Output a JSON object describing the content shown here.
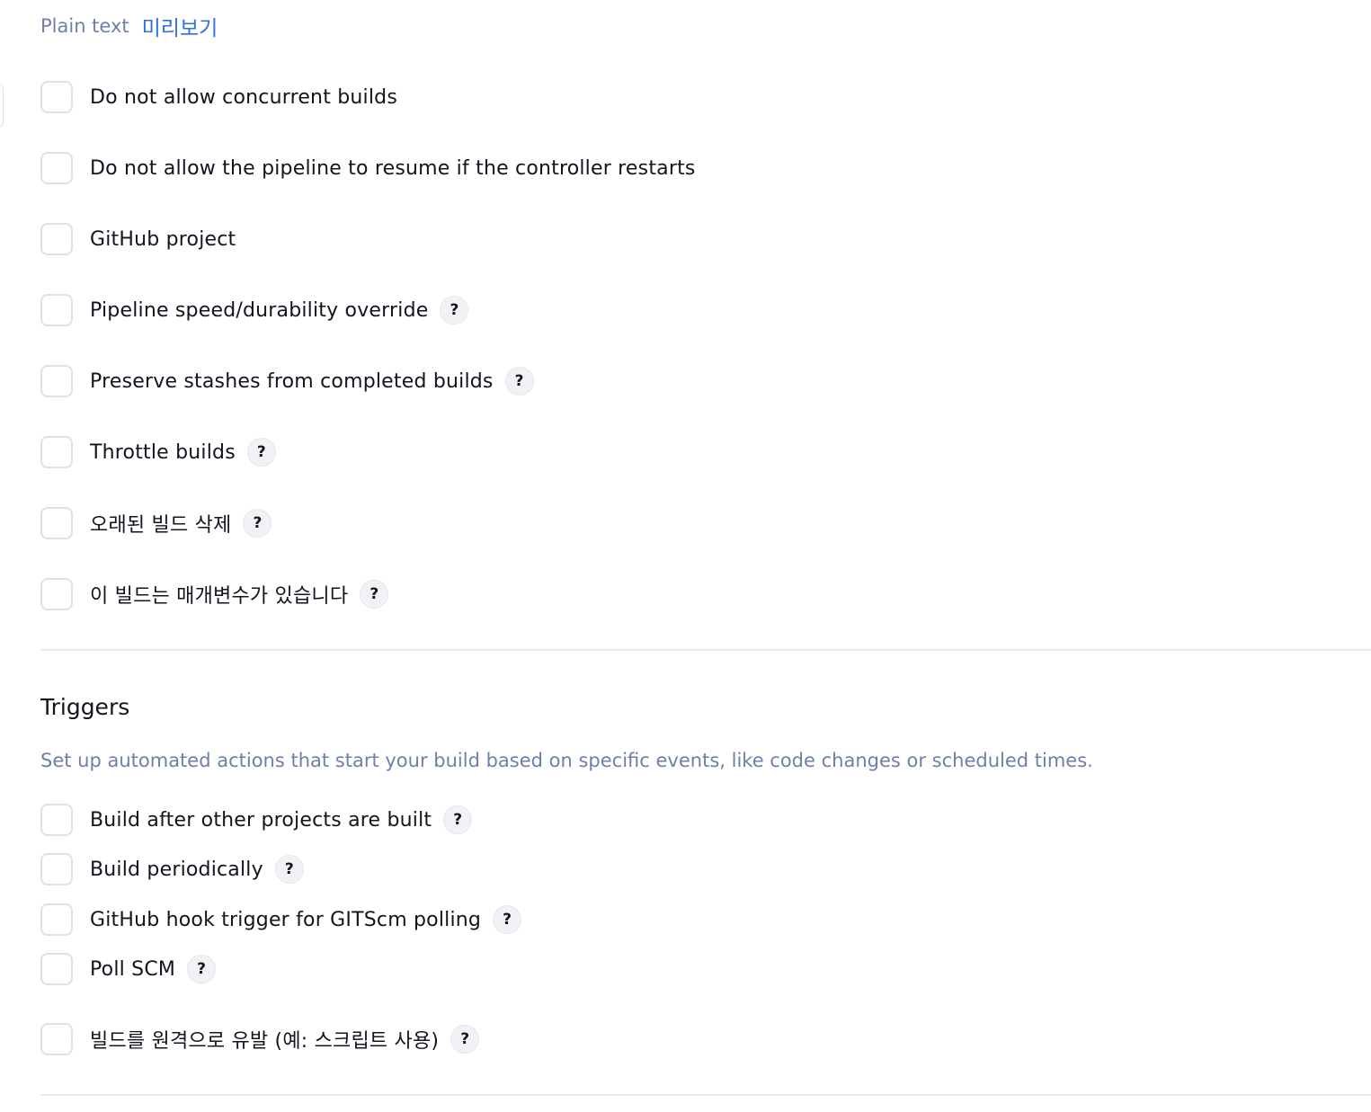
{
  "description_format": {
    "plain_text_label": "Plain text",
    "preview_link": "미리보기"
  },
  "general_options": [
    {
      "label": "Do not allow concurrent builds",
      "checked": false,
      "help": false
    },
    {
      "label": "Do not allow the pipeline to resume if the controller restarts",
      "checked": false,
      "help": false
    },
    {
      "label": "GitHub project",
      "checked": false,
      "help": false
    },
    {
      "label": "Pipeline speed/durability override",
      "checked": false,
      "help": true,
      "help_glyph": "?"
    },
    {
      "label": "Preserve stashes from completed builds",
      "checked": false,
      "help": true,
      "help_glyph": "?"
    },
    {
      "label": "Throttle builds",
      "checked": false,
      "help": true,
      "help_glyph": "?"
    },
    {
      "label": "오래된 빌드 삭제",
      "checked": false,
      "help": true,
      "help_glyph": "?"
    },
    {
      "label": "이 빌드는 매개변수가 있습니다",
      "checked": false,
      "help": true,
      "help_glyph": "?"
    }
  ],
  "triggers": {
    "title": "Triggers",
    "description": "Set up automated actions that start your build based on specific events, like code changes or scheduled times.",
    "options": [
      {
        "label": "Build after other projects are built",
        "checked": false,
        "help": true,
        "help_glyph": "?"
      },
      {
        "label": "Build periodically",
        "checked": false,
        "help": true,
        "help_glyph": "?"
      },
      {
        "label": "GitHub hook trigger for GITScm polling",
        "checked": false,
        "help": true,
        "help_glyph": "?"
      },
      {
        "label": "Poll SCM",
        "checked": false,
        "help": true,
        "help_glyph": "?"
      },
      {
        "label": "빌드를 원격으로 유발 (예: 스크립트 사용)",
        "checked": false,
        "help": true,
        "help_glyph": "?"
      }
    ]
  },
  "colors": {
    "muted_text": "#6e7fa8",
    "link": "#2f6fe0",
    "checkbox_border": "#e0e1e8",
    "divider": "#e9e9ef",
    "help_bg": "#f2f2f6"
  },
  "icons": {
    "help": "question-mark-icon"
  }
}
